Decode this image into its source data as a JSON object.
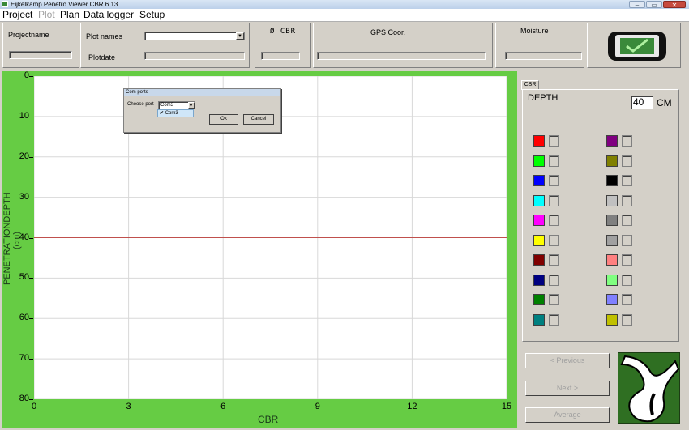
{
  "window": {
    "title": "Eijkelkamp Penetro Viewer CBR 6.13",
    "min_label": "–",
    "max_label": "▭",
    "close_label": "✕"
  },
  "menu": [
    "Project",
    "Plot",
    "Plan",
    "Data logger",
    "Setup"
  ],
  "header": {
    "project_label": "Projectname",
    "plot_names_label": "Plot names",
    "plotdate_label": "Plotdate",
    "cbr_label": "Ø CBR",
    "gps_label": "GPS Coor.",
    "moisture_label": "Moisture"
  },
  "chart_data": {
    "type": "line",
    "x": [
      0,
      15
    ],
    "y": [
      40,
      40
    ],
    "xlabel": "CBR",
    "ylabel": "PENETRATIONDEPTH (cm)",
    "xlim": [
      0,
      15
    ],
    "ylim": [
      0,
      80
    ],
    "y_inverted": true,
    "x_ticks": [
      "0",
      "3",
      "6",
      "9",
      "12",
      "15"
    ],
    "y_ticks": [
      "0",
      "10",
      "20",
      "30",
      "40",
      "50",
      "60",
      "70",
      "80"
    ],
    "grid": true,
    "line_color": "#c0504d",
    "background": "#66cc44"
  },
  "dialog": {
    "title": "Com ports",
    "choose_port_label": "Choose port",
    "selected_port": "Com3",
    "options": [
      "Com3"
    ],
    "ok_label": "Ok",
    "cancel_label": "Cancel"
  },
  "panel": {
    "tab_label": "CBR",
    "depth_label": "DEPTH",
    "depth_value": "40",
    "depth_unit": "CM",
    "colors_left": [
      "#ff0000",
      "#00ff00",
      "#0000ff",
      "#00ffff",
      "#ff00ff",
      "#ffff00",
      "#800000",
      "#000080",
      "#008000",
      "#008080"
    ],
    "colors_right": [
      "#800080",
      "#808000",
      "#000000",
      "#c0c0c0",
      "#808080",
      "#a0a0a0",
      "#ff8080",
      "#80ff80",
      "#8080ff",
      "#c0c000"
    ]
  },
  "buttons": {
    "previous": "< Previous",
    "next": "Next >",
    "average": "Average"
  }
}
